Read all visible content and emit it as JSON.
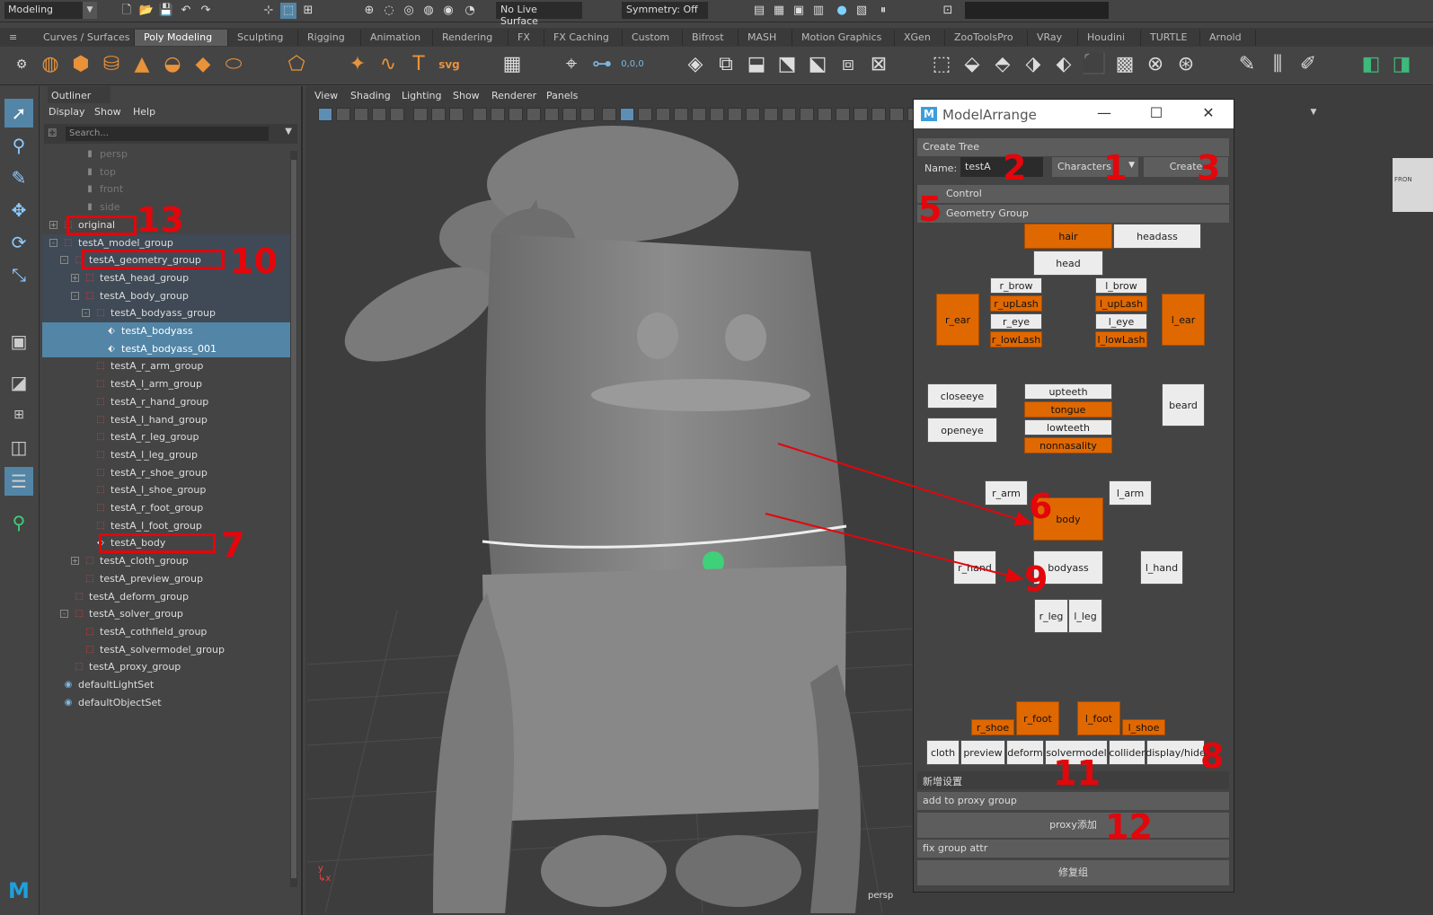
{
  "statusline": {
    "mode": "Modeling",
    "live_surface": "No Live Surface",
    "symmetry": "Symmetry: Off"
  },
  "shelf_tabs": [
    "Curves / Surfaces",
    "Poly Modeling",
    "Sculpting",
    "Rigging",
    "Animation",
    "Rendering",
    "FX",
    "FX Caching",
    "Custom",
    "Bifrost",
    "MASH",
    "Motion Graphics",
    "XGen",
    "ZooToolsPro",
    "VRay",
    "Houdini",
    "TURTLE",
    "Arnold"
  ],
  "active_shelf_tab": "Poly Modeling",
  "shelf_text_icons": {
    "text_tool": "T",
    "svg_tool": "svg",
    "coords": "0,0,0"
  },
  "outliner": {
    "title": "Outliner",
    "menu": [
      "Display",
      "Show",
      "Help"
    ],
    "search_placeholder": "Search...",
    "items": [
      {
        "label": "persp",
        "kind": "camera"
      },
      {
        "label": "top",
        "kind": "camera"
      },
      {
        "label": "front",
        "kind": "camera"
      },
      {
        "label": "side",
        "kind": "camera"
      },
      {
        "label": "original",
        "kind": "group"
      },
      {
        "label": "testA_model_group",
        "kind": "group"
      },
      {
        "label": "testA_geometry_group",
        "kind": "group"
      },
      {
        "label": "testA_head_group",
        "kind": "group"
      },
      {
        "label": "testA_body_group",
        "kind": "group"
      },
      {
        "label": "testA_bodyass_group",
        "kind": "group"
      },
      {
        "label": "testA_bodyass",
        "kind": "mesh"
      },
      {
        "label": "testA_bodyass_001",
        "kind": "mesh"
      },
      {
        "label": "testA_r_arm_group",
        "kind": "group"
      },
      {
        "label": "testA_l_arm_group",
        "kind": "group"
      },
      {
        "label": "testA_r_hand_group",
        "kind": "group"
      },
      {
        "label": "testA_l_hand_group",
        "kind": "group"
      },
      {
        "label": "testA_r_leg_group",
        "kind": "group"
      },
      {
        "label": "testA_l_leg_group",
        "kind": "group"
      },
      {
        "label": "testA_r_shoe_group",
        "kind": "group"
      },
      {
        "label": "testA_l_shoe_group",
        "kind": "group"
      },
      {
        "label": "testA_r_foot_group",
        "kind": "group"
      },
      {
        "label": "testA_l_foot_group",
        "kind": "group"
      },
      {
        "label": "testA_body",
        "kind": "mesh"
      },
      {
        "label": "testA_cloth_group",
        "kind": "group"
      },
      {
        "label": "testA_preview_group",
        "kind": "group"
      },
      {
        "label": "testA_deform_group",
        "kind": "group"
      },
      {
        "label": "testA_solver_group",
        "kind": "group"
      },
      {
        "label": "testA_cothfield_group",
        "kind": "group"
      },
      {
        "label": "testA_solvermodel_group",
        "kind": "group"
      },
      {
        "label": "testA_proxy_group",
        "kind": "group"
      },
      {
        "label": "defaultLightSet",
        "kind": "set"
      },
      {
        "label": "defaultObjectSet",
        "kind": "set"
      }
    ]
  },
  "viewport": {
    "menu": [
      "View",
      "Shading",
      "Lighting",
      "Show",
      "Renderer",
      "Panels"
    ],
    "camera_label": "persp",
    "cube_label": "FRON"
  },
  "model_arrange": {
    "title": "ModelArrange",
    "create_tree_header": "Create Tree",
    "name_label": "Name:",
    "name_value": "testA",
    "category": "Characters",
    "create_button": "Create",
    "control_header": "Control",
    "geometry_header": "Geometry Group",
    "buttons": {
      "hair": "hair",
      "headass": "headass",
      "head": "head",
      "r_brow": "r_brow",
      "r_upLash": "r_upLash",
      "r_eye": "r_eye",
      "r_lowLash": "r_lowLash",
      "l_brow": "l_brow",
      "l_upLash": "l_upLash",
      "l_eye": "l_eye",
      "l_lowLash": "l_lowLash",
      "r_ear": "r_ear",
      "l_ear": "l_ear",
      "closeeye": "closeeye",
      "openeye": "openeye",
      "upteeth": "upteeth",
      "tongue": "tongue",
      "lowteeth": "lowteeth",
      "nonnasality": "nonnasality",
      "beard": "beard",
      "r_arm": "r_arm",
      "l_arm": "l_arm",
      "body": "body",
      "r_hand": "r_hand",
      "bodyass": "bodyass",
      "l_hand": "l_hand",
      "r_leg": "r_leg",
      "l_leg": "l_leg",
      "r_shoe": "r_shoe",
      "r_foot": "r_foot",
      "l_foot": "l_foot",
      "l_shoe": "l_shoe"
    },
    "bottom_buttons": [
      "cloth",
      "preview",
      "deform",
      "solvermodel",
      "collider",
      "display/hide"
    ],
    "new_settings_header": "新增设置",
    "proxy_header": "add to proxy group",
    "proxy_button": "proxy添加",
    "fix_header": "fix group attr",
    "fix_button": "修复组"
  },
  "callouts": [
    "1",
    "2",
    "3",
    "5",
    "6",
    "7",
    "8",
    "9",
    "10",
    "11",
    "12",
    "13"
  ],
  "colors": {
    "accent_orange": "#e06800",
    "selection_blue": "#5285a6",
    "annotation_red": "#e3060b"
  }
}
